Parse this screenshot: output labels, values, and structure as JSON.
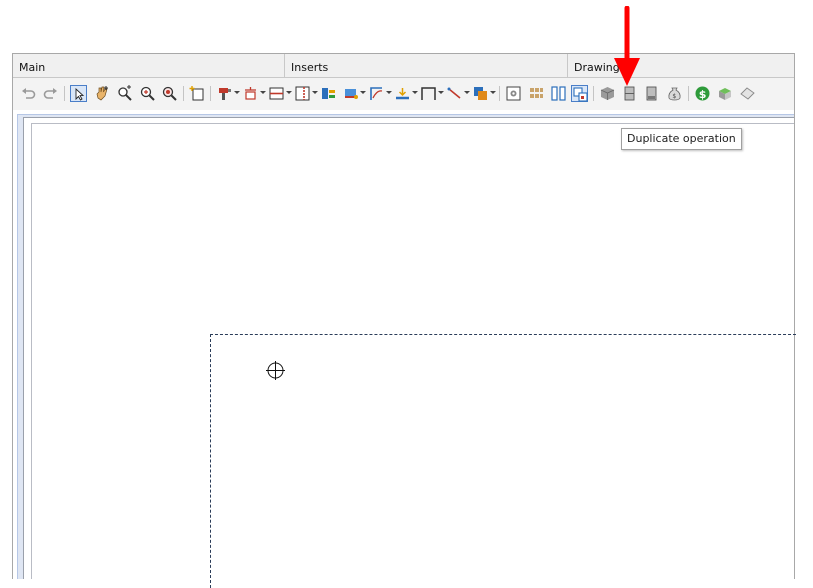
{
  "tabs": [
    {
      "label": "Main"
    },
    {
      "label": "Inserts"
    },
    {
      "label": "Drawing"
    }
  ],
  "toolbar": {
    "tooltip": "Duplicate operation",
    "icons": [
      "undo-icon",
      "redo-icon",
      "select-pointer-icon",
      "pan-hand-icon",
      "zoom-extents-icon",
      "zoom-in-icon",
      "zoom-window-icon",
      "new-panel-icon",
      "drill-tool-icon",
      "hinge-icon",
      "shelf-icon",
      "divider-icon",
      "fixing-icon",
      "edge-band-icon",
      "profile-icon",
      "bottom-icon",
      "frame-icon",
      "line-icon",
      "insert-group-icon",
      "settings-icon",
      "pattern-icon",
      "split-icon",
      "duplicate-operation-icon",
      "box-3d-icon",
      "front-view-icon",
      "side-view-icon",
      "cost-bag-icon",
      "dollar-icon",
      "material-icon"
    ]
  },
  "colors": {
    "accent": "#4a7ec8",
    "annotation_arrow": "#ff0000",
    "canvas_border": "#b6c7e6"
  }
}
